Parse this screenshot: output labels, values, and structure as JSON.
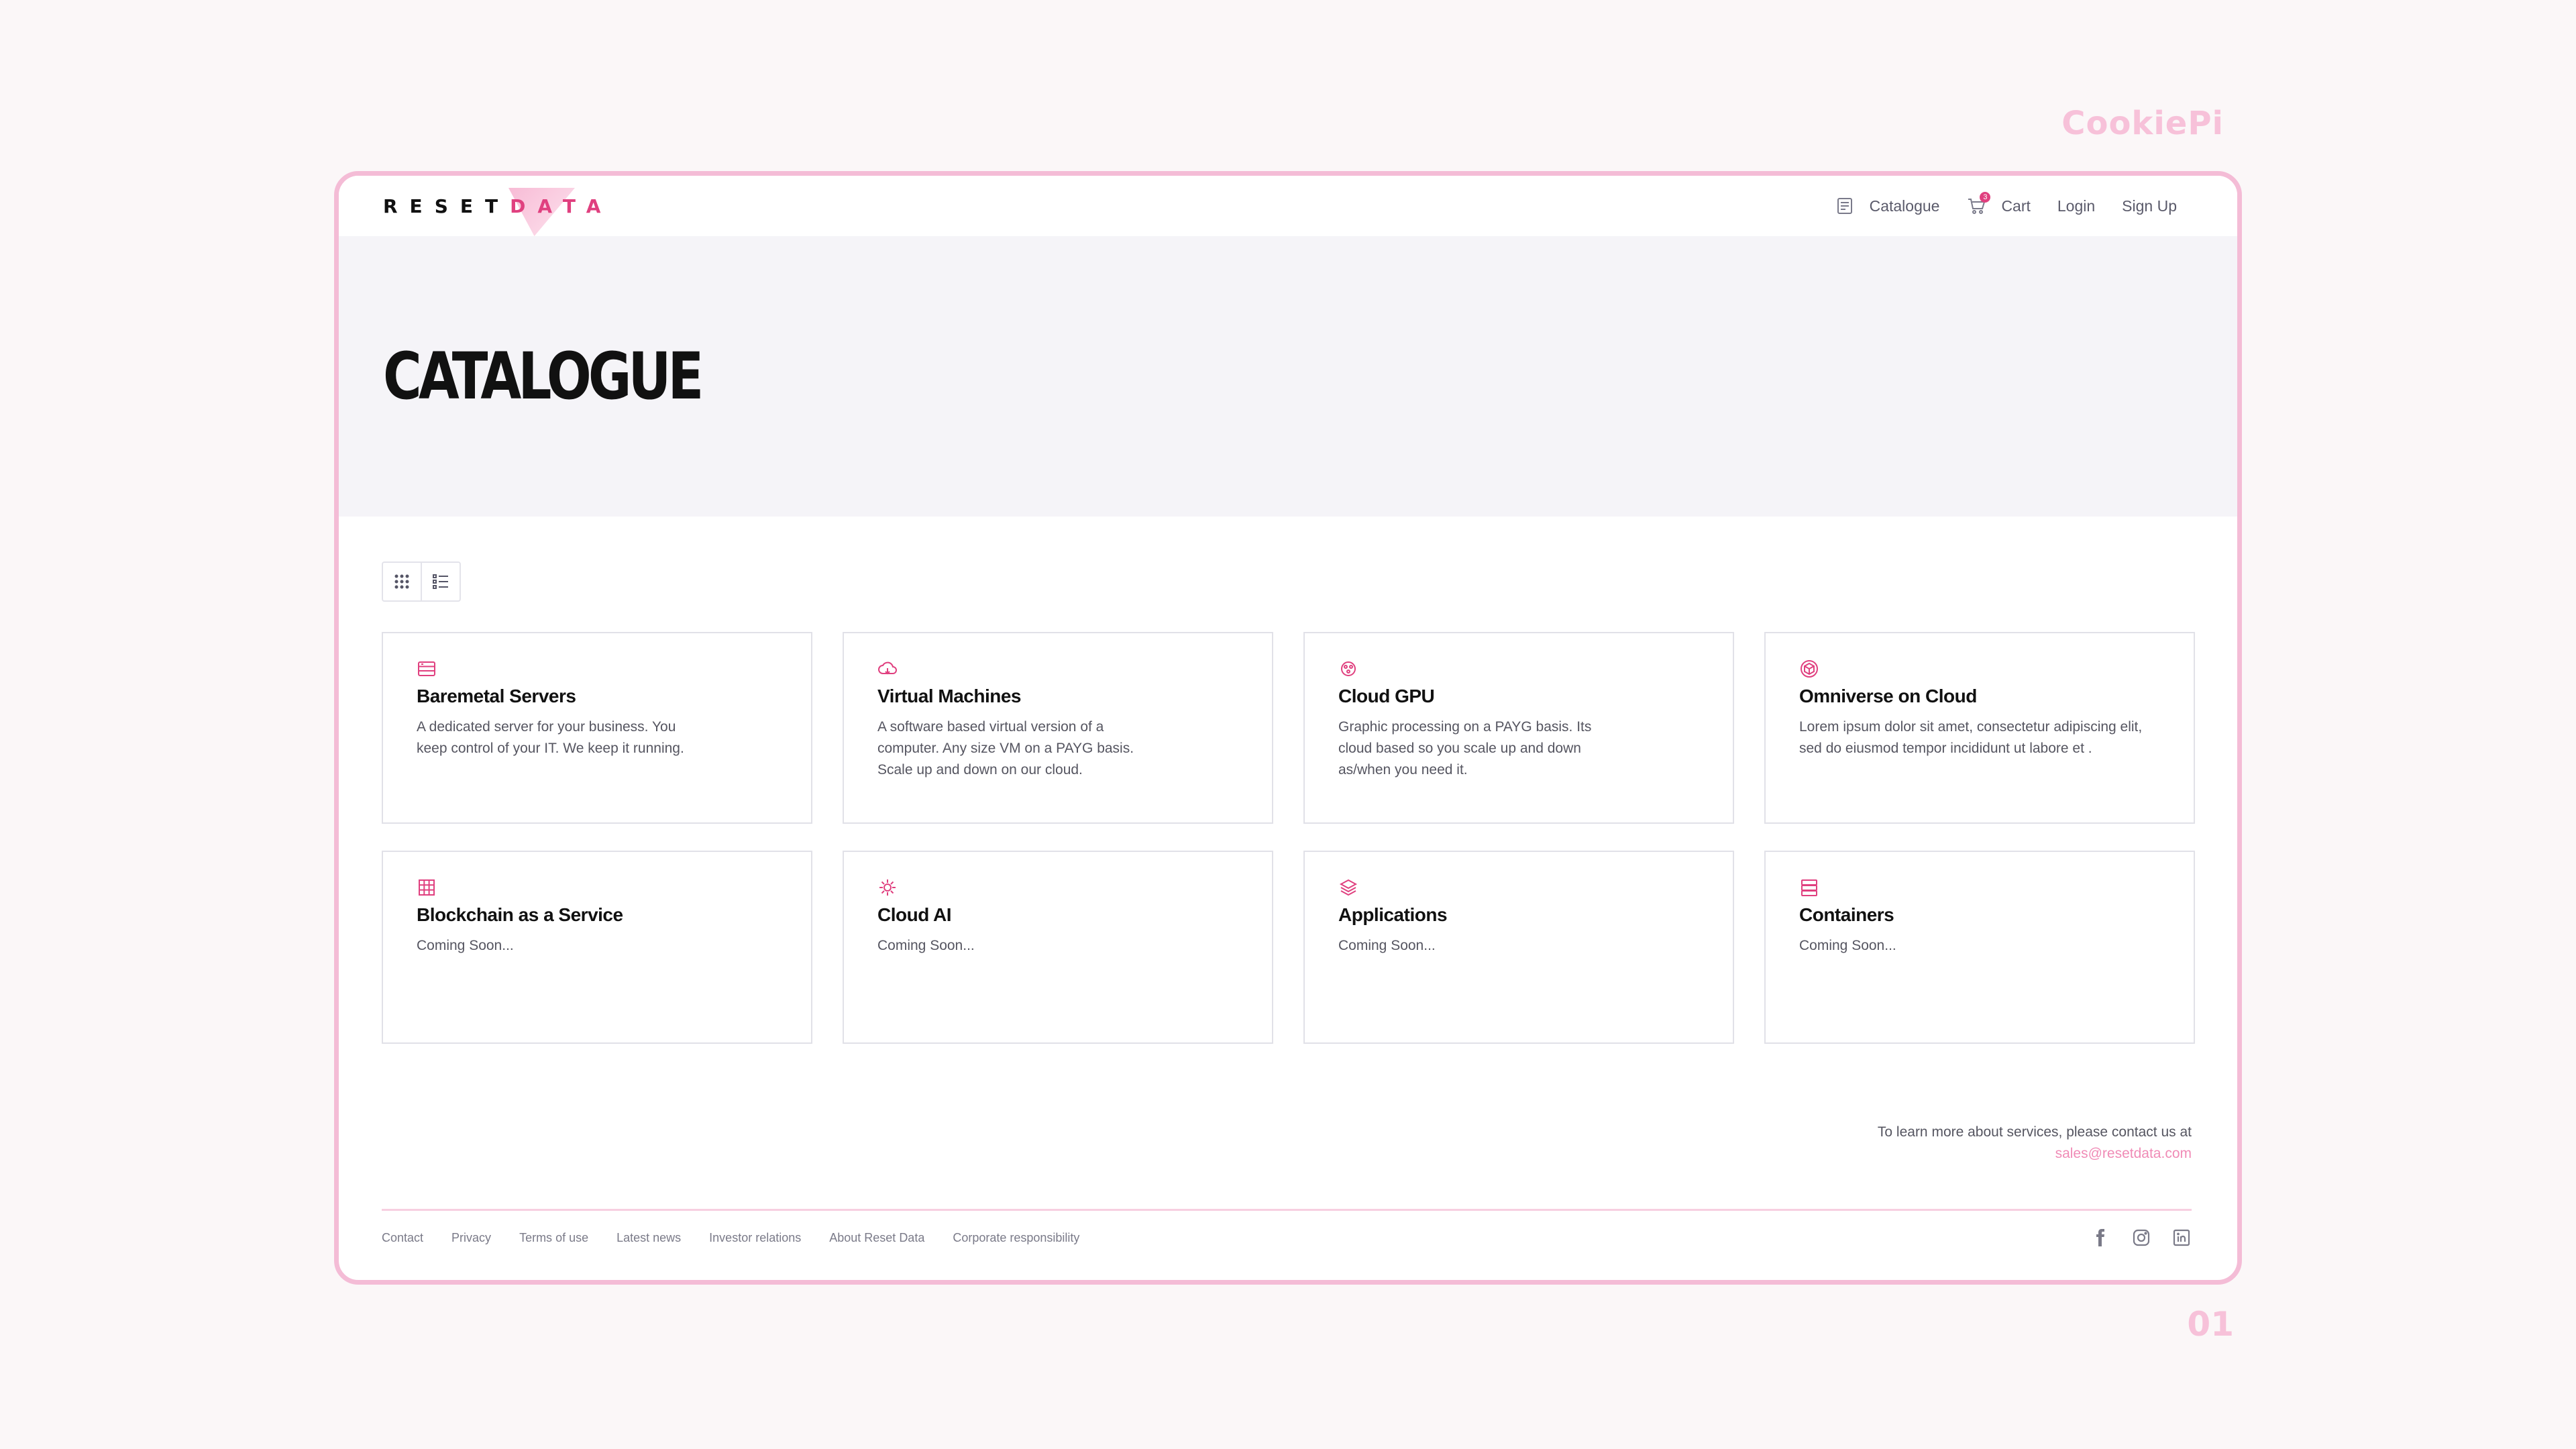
{
  "watermark": "CookiePi",
  "page_number": "01",
  "logo": {
    "part1": "RESET",
    "part2": "DATA"
  },
  "nav": {
    "catalogue": "Catalogue",
    "cart": "Cart",
    "cart_count": "3",
    "login": "Login",
    "signup": "Sign Up"
  },
  "hero": {
    "title": "CATALOGUE"
  },
  "cards": [
    {
      "icon": "server-icon",
      "title": "Baremetal Servers",
      "desc": "A dedicated server for your business. You keep control of your IT. We keep it running."
    },
    {
      "icon": "cloud-icon",
      "title": "Virtual Machines",
      "desc": "A software based virtual version of a computer. Any size VM on a PAYG basis. Scale up and down on our cloud."
    },
    {
      "icon": "gpu-icon",
      "title": "Cloud GPU",
      "desc": "Graphic processing on a PAYG basis. Its cloud based so you scale up and down as/when you need it."
    },
    {
      "icon": "cube-icon",
      "title": "Omniverse on Cloud",
      "desc": "Lorem ipsum dolor sit amet, consectetur adipiscing elit, sed do eiusmod tempor incididunt ut labore et ."
    },
    {
      "icon": "blockchain-icon",
      "title": "Blockchain as a Service",
      "desc": "Coming Soon..."
    },
    {
      "icon": "ai-icon",
      "title": "Cloud AI",
      "desc": "Coming Soon..."
    },
    {
      "icon": "layers-icon",
      "title": "Applications",
      "desc": "Coming Soon..."
    },
    {
      "icon": "container-icon",
      "title": "Containers",
      "desc": "Coming Soon..."
    }
  ],
  "contact": {
    "text": "To learn more about services, please contact us at",
    "email": "sales@resetdata.com"
  },
  "footer": {
    "links": [
      "Contact",
      "Privacy",
      "Terms of use",
      "Latest news",
      "Investor relations",
      "About Reset Data",
      "Corporate responsibility"
    ]
  },
  "colors": {
    "accent": "#e0407f",
    "frame": "#f4bcd6",
    "hero_bg": "#f5f4f8"
  }
}
